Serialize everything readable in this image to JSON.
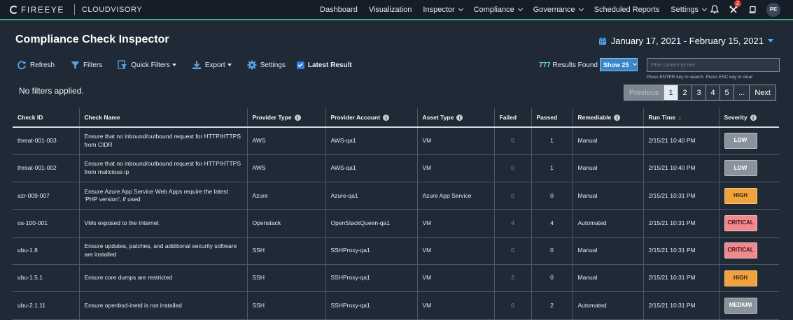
{
  "nav": {
    "brand": "FIREEYE",
    "product": "CLOUDVISORY",
    "links": [
      {
        "label": "Dashboard",
        "dropdown": false
      },
      {
        "label": "Visualization",
        "dropdown": false
      },
      {
        "label": "Inspector",
        "dropdown": true
      },
      {
        "label": "Compliance",
        "dropdown": true
      },
      {
        "label": "Governance",
        "dropdown": true
      },
      {
        "label": "Scheduled Reports",
        "dropdown": false
      },
      {
        "label": "Settings",
        "dropdown": true
      }
    ],
    "notification_count": "2",
    "avatar_initials": "PE"
  },
  "page": {
    "title": "Compliance Check Inspector",
    "date_range": "January 17, 2021 - February 15, 2021"
  },
  "toolbar": {
    "refresh": "Refresh",
    "filters": "Filters",
    "quick_filters": "Quick Filters",
    "export": "Export",
    "settings": "Settings",
    "latest_result": "Latest Result",
    "latest_checked": true
  },
  "results": {
    "count": "777",
    "label": "Results Found",
    "show_label": "Show 25"
  },
  "search": {
    "placeholder": "Filter content by text",
    "hint": "Press ENTER key to search. Press ESC key to clear"
  },
  "filters_status": "No filters applied.",
  "pagination": {
    "previous": "Previous",
    "pages": [
      "1",
      "2",
      "3",
      "4",
      "5",
      "..."
    ],
    "active": "1",
    "next": "Next"
  },
  "table": {
    "columns": [
      {
        "label": "Check ID",
        "info": false
      },
      {
        "label": "Check Name",
        "info": false
      },
      {
        "label": "Provider Type",
        "info": true
      },
      {
        "label": "Provider Account",
        "info": true
      },
      {
        "label": "Asset Type",
        "info": true
      },
      {
        "label": "Failed",
        "info": false
      },
      {
        "label": "Passed",
        "info": false
      },
      {
        "label": "Remediable",
        "info": true
      },
      {
        "label": "Run Time",
        "info": false,
        "sort": "desc"
      },
      {
        "label": "Severity",
        "info": true
      }
    ],
    "rows": [
      {
        "check_id": "threat-001-003",
        "check_name": "Ensure that no inbound/outbound request for HTTP/HTTPS from CIDR",
        "provider_type": "AWS",
        "provider_account": "AWS-qa1",
        "asset_type": "VM",
        "failed": "0",
        "passed": "1",
        "remediable": "Manual",
        "run_time": "2/15/21 10:40 PM",
        "severity": "LOW"
      },
      {
        "check_id": "threat-001-002",
        "check_name": "Ensure that no inbound/outbound request for HTTP/HTTPS from malicious ip",
        "provider_type": "AWS",
        "provider_account": "AWS-qa1",
        "asset_type": "VM",
        "failed": "0",
        "passed": "1",
        "remediable": "Manual",
        "run_time": "2/15/21 10:40 PM",
        "severity": "LOW"
      },
      {
        "check_id": "azr-009-007",
        "check_name": "Ensure Azure App Service Web Apps require the latest 'PHP version', if used",
        "provider_type": "Azure",
        "provider_account": "Azure-qa1",
        "asset_type": "Azure App Service",
        "failed": "0",
        "passed": "0",
        "remediable": "Manual",
        "run_time": "2/15/21 10:31 PM",
        "severity": "HIGH"
      },
      {
        "check_id": "os-100-001",
        "check_name": "VMs exposed to the Internet",
        "provider_type": "Openstack",
        "provider_account": "OpenStackQueen-qa1",
        "asset_type": "VM",
        "failed": "4",
        "passed": "4",
        "remediable": "Automated",
        "run_time": "2/15/21 10:31 PM",
        "severity": "CRITICAL"
      },
      {
        "check_id": "ubu-1.8",
        "check_name": "Ensure updates, patches, and additional security software are installed",
        "provider_type": "SSH",
        "provider_account": "SSHProxy-qa1",
        "asset_type": "VM",
        "failed": "0",
        "passed": "0",
        "remediable": "Manual",
        "run_time": "2/15/21 10:31 PM",
        "severity": "CRITICAL"
      },
      {
        "check_id": "ubu-1.5.1",
        "check_name": "Ensure core dumps are restricted",
        "provider_type": "SSH",
        "provider_account": "SSHProxy-qa1",
        "asset_type": "VM",
        "failed": "2",
        "passed": "0",
        "remediable": "Manual",
        "run_time": "2/15/21 10:31 PM",
        "severity": "HIGH"
      },
      {
        "check_id": "ubu-2.1.11",
        "check_name": "Ensure openbsd-inetd is not installed",
        "provider_type": "SSH",
        "provider_account": "SSHProxy-qa1",
        "asset_type": "VM",
        "failed": "0",
        "passed": "2",
        "remediable": "Automated",
        "run_time": "2/15/21 10:31 PM",
        "severity": "MEDIUM"
      }
    ]
  },
  "severity_colors": {
    "LOW": {
      "bg": "#8a939c",
      "fg": "#ffffff"
    },
    "HIGH": {
      "bg": "#f0a23c",
      "fg": "#3a2a10"
    },
    "CRITICAL": {
      "bg": "#f08a8f",
      "fg": "#4a1418"
    },
    "MEDIUM": {
      "bg": "#8a939c",
      "fg": "#ffffff"
    }
  },
  "colors": {
    "accent": "#3fae8a",
    "link_blue": "#5aa3e8",
    "count": "#6fd3d6"
  }
}
